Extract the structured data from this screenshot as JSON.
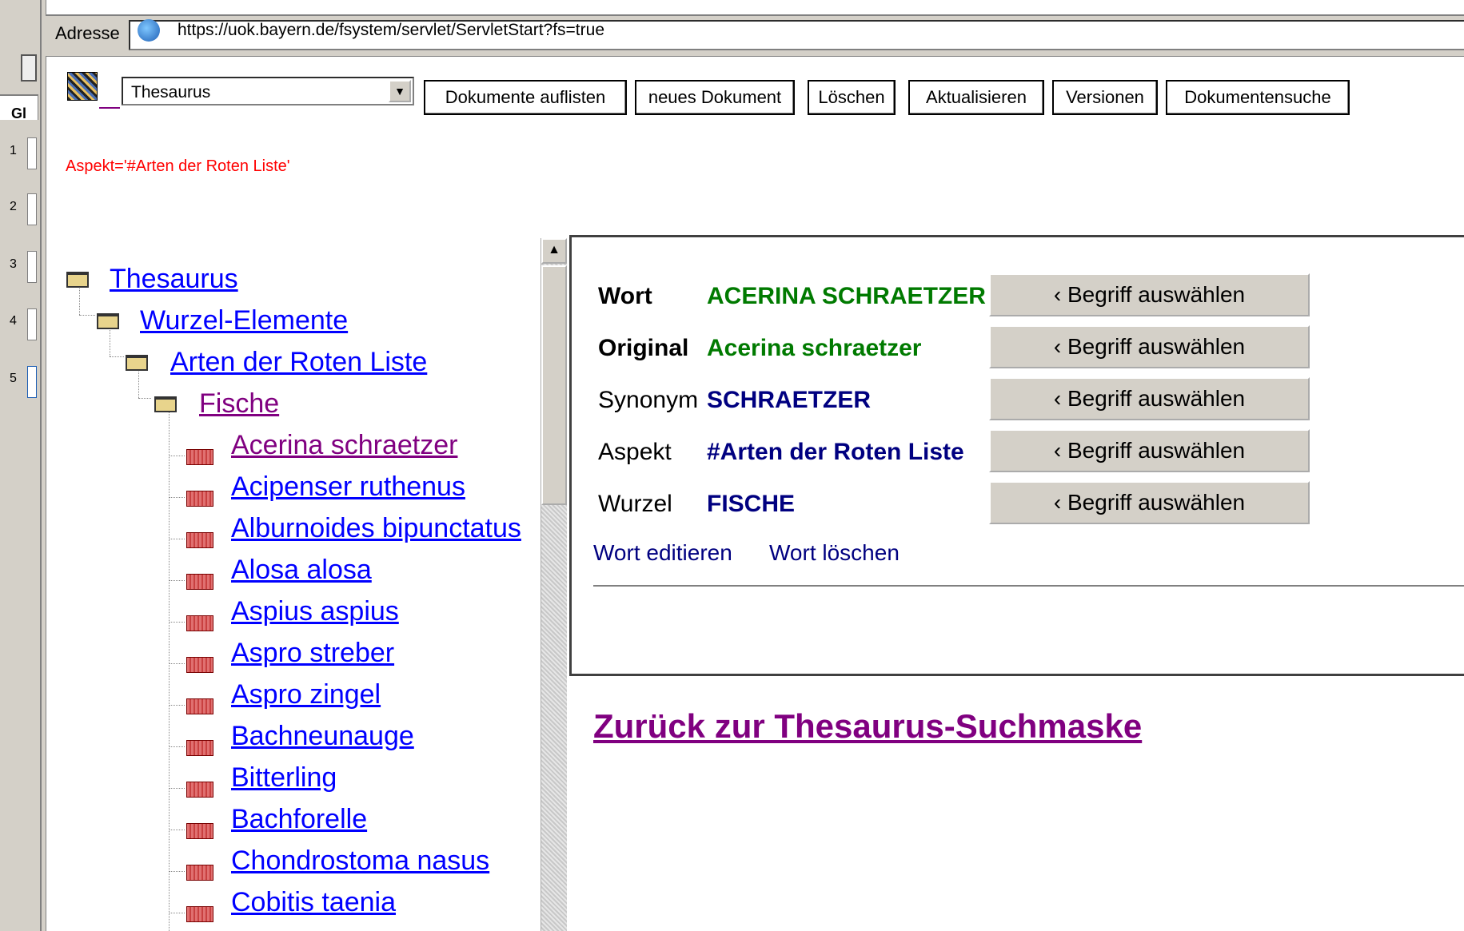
{
  "address_bar": {
    "label": "Adresse",
    "url": "https://uok.bayern.de/fsystem/servlet/ServletStart?fs=true"
  },
  "left_strip": {
    "tab_text": "Gl",
    "row_numbers": [
      "1",
      "2",
      "3",
      "4",
      "5"
    ]
  },
  "toolbar": {
    "select_value": "Thesaurus",
    "buttons": [
      "Dokumente auflisten",
      "neues Dokument",
      "Löschen",
      "Aktualisieren",
      "Versionen",
      "Dokumentensuche"
    ]
  },
  "aspect_line": "Aspekt='#Arten der Roten Liste'",
  "tree": {
    "root": "Thesaurus",
    "level1": "Wurzel-Elemente",
    "level2": "Arten der Roten Liste",
    "level3": "Fische",
    "leaves": [
      "Acerina schraetzer",
      "Acipenser ruthenus",
      "Alburnoides bipunctatus",
      "Alosa alosa",
      "Aspius aspius",
      "Aspro streber",
      "Aspro zingel",
      "Bachneunauge",
      "Bitterling",
      "Bachforelle",
      "Chondrostoma nasus",
      "Cobitis taenia"
    ]
  },
  "detail": {
    "fields": [
      {
        "label": "Wort",
        "value": "ACERINA SCHRAETZER"
      },
      {
        "label": "Original",
        "value": "Acerina schraetzer"
      },
      {
        "label": "Synonym",
        "value": "SCHRAETZER"
      },
      {
        "label": "Aspekt",
        "value": "#Arten der Roten Liste"
      },
      {
        "label": "Wurzel",
        "value": "FISCHE"
      }
    ],
    "select_button": "‹ Begriff auswählen",
    "edit_link": "Wort editieren",
    "delete_link": "Wort löschen"
  },
  "back_link": "Zurück zur Thesaurus-Suchmaske",
  "colors": {
    "link_blue": "#0000ff",
    "link_visited": "#800080",
    "value_green": "#007a00",
    "value_navy": "#000080",
    "aspect_red": "#ff0000"
  }
}
